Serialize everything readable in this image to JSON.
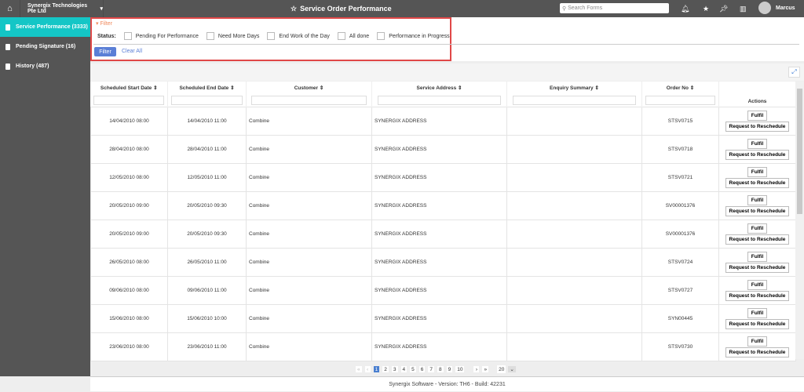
{
  "topbar": {
    "company": "Synergix Technologies Pte Ltd",
    "title": "Service Order Performance",
    "search_placeholder": "Search Forms",
    "user": "Marcus"
  },
  "sidebar": {
    "items": [
      {
        "label": "Service Performance (3333)"
      },
      {
        "label": "Pending Signature (16)"
      },
      {
        "label": "History (487)"
      }
    ]
  },
  "filter": {
    "toggle": "Filter",
    "status_label": "Status:",
    "options": [
      "Pending For Performance",
      "Need More Days",
      "End Work of the Day",
      "All done",
      "Performance in Progress"
    ],
    "filter_button": "Filter",
    "clear_all": "Clear All"
  },
  "table": {
    "headers": [
      "Scheduled Start Date",
      "Scheduled End Date",
      "Customer",
      "Service Address",
      "Enquiry Summary",
      "Order No",
      "Actions"
    ],
    "rows": [
      [
        "14/04/2010 08:00",
        "14/04/2010 11:00",
        "Combine",
        "SYNERGIX ADDRESS",
        "",
        "STSV0715"
      ],
      [
        "28/04/2010 08:00",
        "28/04/2010 11:00",
        "Combine",
        "SYNERGIX ADDRESS",
        "",
        "STSV0718"
      ],
      [
        "12/05/2010 08:00",
        "12/05/2010 11:00",
        "Combine",
        "SYNERGIX ADDRESS",
        "",
        "STSV0721"
      ],
      [
        "20/05/2010 09:00",
        "20/05/2010 09:30",
        "Combine",
        "SYNERGIX ADDRESS",
        "",
        "SV00001376"
      ],
      [
        "20/05/2010 09:00",
        "20/05/2010 09:30",
        "Combine",
        "SYNERGIX ADDRESS",
        "",
        "SV00001376"
      ],
      [
        "26/05/2010 08:00",
        "26/05/2010 11:00",
        "Combine",
        "SYNERGIX ADDRESS",
        "",
        "STSV0724"
      ],
      [
        "09/06/2010 08:00",
        "09/06/2010 11:00",
        "Combine",
        "SYNERGIX ADDRESS",
        "",
        "STSV0727"
      ],
      [
        "15/06/2010 08:00",
        "15/06/2010 10:00",
        "Combine",
        "SYNERGIX ADDRESS",
        "",
        "SYN00445"
      ],
      [
        "23/06/2010 08:00",
        "23/06/2010 11:00",
        "Combine",
        "SYNERGIX ADDRESS",
        "",
        "STSV0730"
      ]
    ],
    "fulfil": "Fulfil",
    "reschedule": "Request to Reschedule"
  },
  "pager": {
    "first": "«",
    "prev": "‹",
    "pages": [
      "1",
      "2",
      "3",
      "4",
      "5",
      "6",
      "7",
      "8",
      "9",
      "10"
    ],
    "current": "1",
    "next": "›",
    "last": "»",
    "page_size": "20"
  },
  "footer": "Synergix Software - Version: TH6 - Build: 42231"
}
